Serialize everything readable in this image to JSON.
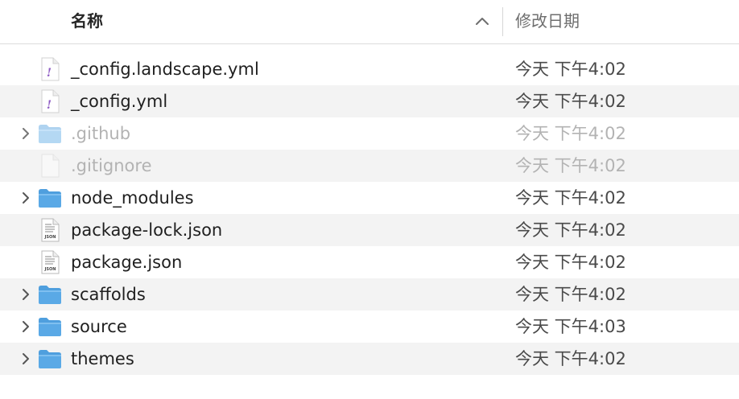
{
  "header": {
    "name_label": "名称",
    "date_label": "修改日期",
    "sort_direction": "ascending"
  },
  "colors": {
    "folder_blue": "#5aa9e6",
    "yaml_badge_purple": "#8e5bc4",
    "alt_row": "#f3f3f3",
    "hidden_text": "#b3b3b3"
  },
  "files": [
    {
      "name": "_config.landscape.yml",
      "date": "今天 下午4:02",
      "icon": "yaml-file-icon",
      "expandable": false,
      "hidden": false
    },
    {
      "name": "_config.yml",
      "date": "今天 下午4:02",
      "icon": "yaml-file-icon",
      "expandable": false,
      "hidden": false
    },
    {
      "name": ".github",
      "date": "今天 下午4:02",
      "icon": "folder-icon",
      "expandable": true,
      "hidden": true
    },
    {
      "name": ".gitignore",
      "date": "今天 下午4:02",
      "icon": "blank-file-icon",
      "expandable": false,
      "hidden": true
    },
    {
      "name": "node_modules",
      "date": "今天 下午4:02",
      "icon": "folder-icon",
      "expandable": true,
      "hidden": false
    },
    {
      "name": "package-lock.json",
      "date": "今天 下午4:02",
      "icon": "json-file-icon",
      "expandable": false,
      "hidden": false
    },
    {
      "name": "package.json",
      "date": "今天 下午4:02",
      "icon": "json-file-icon",
      "expandable": false,
      "hidden": false
    },
    {
      "name": "scaffolds",
      "date": "今天 下午4:02",
      "icon": "folder-icon",
      "expandable": true,
      "hidden": false
    },
    {
      "name": "source",
      "date": "今天 下午4:03",
      "icon": "folder-icon",
      "expandable": true,
      "hidden": false
    },
    {
      "name": "themes",
      "date": "今天 下午4:02",
      "icon": "folder-icon",
      "expandable": true,
      "hidden": false
    }
  ]
}
